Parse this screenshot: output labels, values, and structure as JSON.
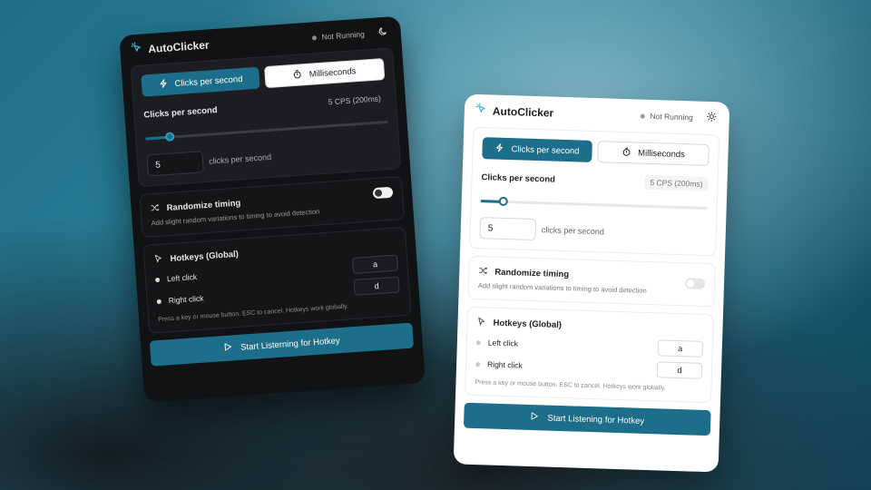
{
  "app": {
    "title": "AutoClicker",
    "status": "Not Running",
    "colors": {
      "accent": "#1c6e8a",
      "brand_icon": "#3fb7d9",
      "status_dot": "#8a8a8a"
    }
  },
  "mode": {
    "cps_label": "Clicks per second",
    "ms_label": "Milliseconds",
    "cps_icon": "lightning-icon",
    "ms_icon": "stopwatch-icon",
    "selected": "Clicks per second"
  },
  "rate": {
    "label": "Clicks per second",
    "badge": "5 CPS (200ms)",
    "value": "5",
    "suffix": "clicks per second",
    "slider_fraction": 0.1
  },
  "randomize": {
    "title": "Randomize timing",
    "description": "Add slight random variations to timing to avoid detection",
    "enabled": false,
    "icon": "shuffle-icon"
  },
  "hotkeys": {
    "title": "Hotkeys (Global)",
    "icon": "cursor-icon",
    "left_label": "Left click",
    "left_key": "a",
    "right_label": "Right click",
    "right_key": "d",
    "hint": "Press a key or mouse button. ESC to cancel. Hotkeys work globally."
  },
  "start": {
    "label": "Start Listerning for Hotkey",
    "label_light": "Start Listening for Hotkey",
    "icon": "play-icon"
  },
  "theme": {
    "dark_icon": "moon-icon",
    "light_icon": "sun-icon"
  }
}
